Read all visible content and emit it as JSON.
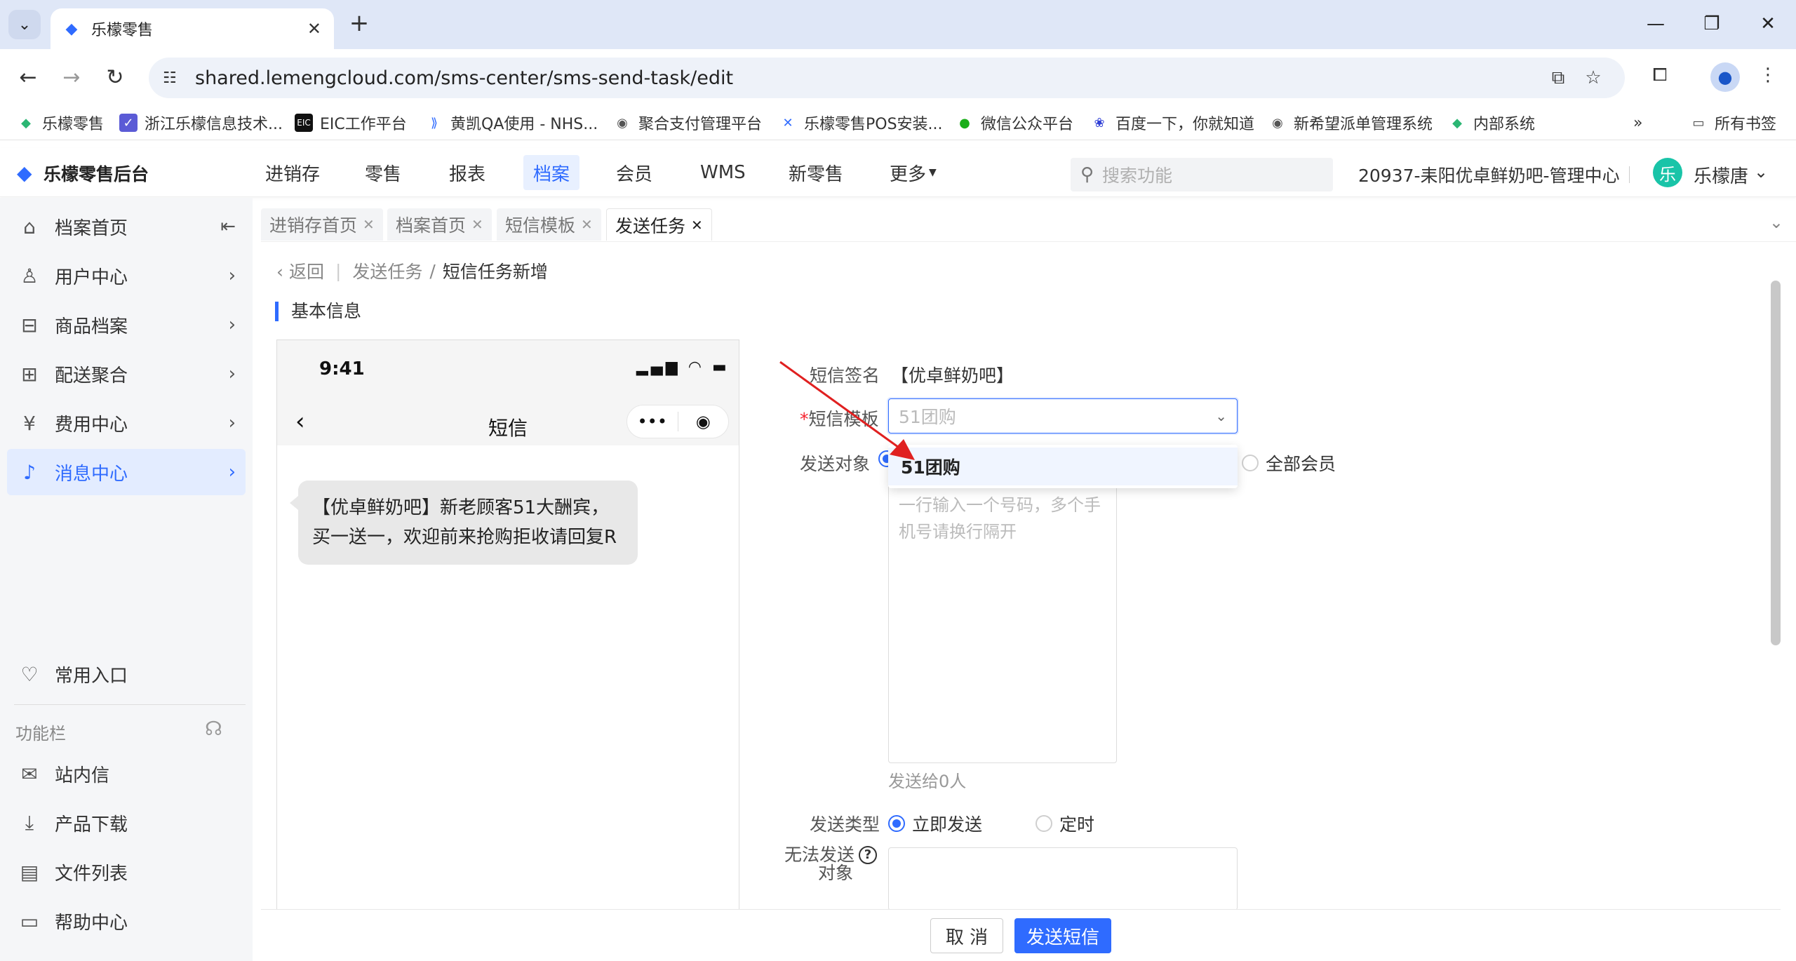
{
  "browser": {
    "tab_title": "乐檬零售",
    "url": "shared.lemengcloud.com/sms-center/sms-send-task/edit",
    "bookmarks": [
      {
        "label": "乐檬零售"
      },
      {
        "label": "浙江乐檬信息技术..."
      },
      {
        "label": "EIC工作平台"
      },
      {
        "label": "黄凯QA使用 - NHS..."
      },
      {
        "label": "聚合支付管理平台"
      },
      {
        "label": "乐檬零售POS安装..."
      },
      {
        "label": "微信公众平台"
      },
      {
        "label": "百度一下，你就知道"
      },
      {
        "label": "新希望派单管理系统"
      },
      {
        "label": "内部系统"
      }
    ],
    "more_bookmarks": "»",
    "all_bookmarks": "所有书签"
  },
  "app": {
    "logo": "乐檬零售后台",
    "nav": [
      "进销存",
      "零售",
      "报表",
      "档案",
      "会员",
      "WMS",
      "新零售",
      "更多"
    ],
    "nav_active": "档案",
    "search_placeholder": "搜索功能",
    "store": "20937-耒阳优卓鲜奶吧-管理中心",
    "user_initial": "乐",
    "user_name": "乐檬唐"
  },
  "sidebar": {
    "items": [
      {
        "label": "档案首页"
      },
      {
        "label": "用户中心"
      },
      {
        "label": "商品档案"
      },
      {
        "label": "配送聚合"
      },
      {
        "label": "费用中心"
      },
      {
        "label": "消息中心"
      }
    ],
    "common_entry": "常用入口",
    "func_bar": "功能栏",
    "bottom_items": [
      {
        "label": "站内信"
      },
      {
        "label": "产品下载"
      },
      {
        "label": "文件列表"
      },
      {
        "label": "帮助中心"
      }
    ]
  },
  "page_tabs": [
    {
      "label": "进销存首页"
    },
    {
      "label": "档案首页"
    },
    {
      "label": "短信模板"
    },
    {
      "label": "发送任务"
    }
  ],
  "breadcrumb": {
    "back": "返回",
    "parent": "发送任务",
    "sep": "/",
    "current": "短信任务新增"
  },
  "section_title": "基本信息",
  "phone": {
    "time": "9:41",
    "title": "短信",
    "message": "【优卓鲜奶吧】新老顾客51大酬宾，买一送一，欢迎前来抢购拒收请回复R"
  },
  "form": {
    "signature_label": "短信签名",
    "signature_value": "【优卓鲜奶吧】",
    "template_label": "短信模板",
    "template_value": "51团购",
    "template_option": "51团购",
    "target_label": "发送对象",
    "target_all": "全部会员",
    "phones_placeholder": "一行输入一个号码，多个手机号请换行隔开",
    "send_hint": "发送给0人",
    "type_label": "发送类型",
    "type_immediate": "立即发送",
    "type_scheduled": "定时",
    "unsendable_label_1": "无法发送",
    "unsendable_label_2": "对象"
  },
  "footer": {
    "cancel": "取 消",
    "send": "发送短信"
  },
  "colors": {
    "primary": "#2f6bff",
    "required": "#f5222d",
    "annotation": "#e02020"
  }
}
